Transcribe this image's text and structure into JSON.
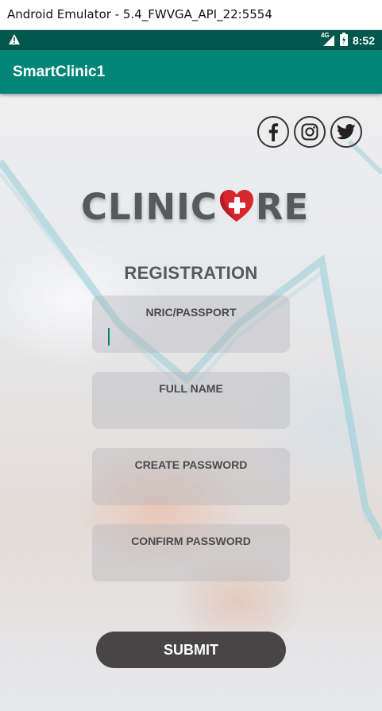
{
  "window": {
    "title": "Android Emulator - 5.4_FWVGA_API_22:5554"
  },
  "status_bar": {
    "network": "4G",
    "time": "8:52"
  },
  "app_bar": {
    "title": "SmartClinic1"
  },
  "social": {
    "icons": [
      "facebook-icon",
      "instagram-icon",
      "twitter-icon"
    ]
  },
  "logo": {
    "left_text": "CLINIC",
    "right_text": "RE"
  },
  "form": {
    "title": "REGISTRATION",
    "fields": [
      {
        "label": "NRIC/PASSPORT",
        "value": ""
      },
      {
        "label": "FULL NAME",
        "value": ""
      },
      {
        "label": "CREATE PASSWORD",
        "value": ""
      },
      {
        "label": "CONFIRM PASSWORD",
        "value": ""
      }
    ],
    "submit_label": "SUBMIT"
  },
  "colors": {
    "status_bar": "#00574b",
    "app_bar": "#008577",
    "submit": "#474546",
    "logo_text": "#58595b",
    "heart": "#d8262e"
  }
}
